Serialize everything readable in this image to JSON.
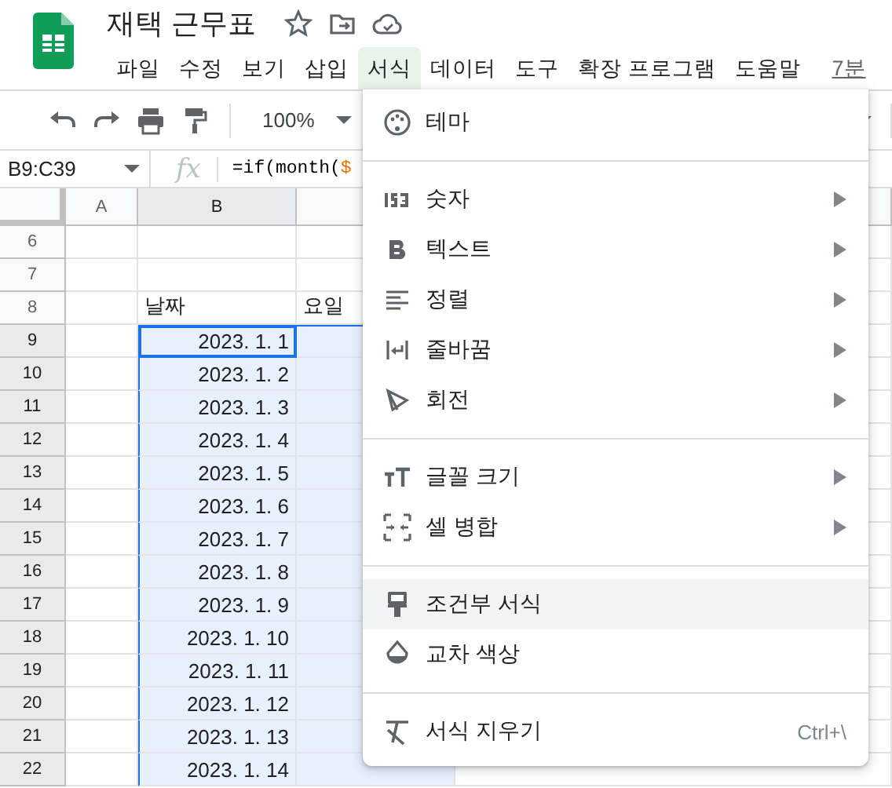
{
  "document": {
    "title": "재택 근무표"
  },
  "menubar": [
    {
      "label": "파일",
      "selected": false
    },
    {
      "label": "수정",
      "selected": false
    },
    {
      "label": "보기",
      "selected": false
    },
    {
      "label": "삽입",
      "selected": false
    },
    {
      "label": "서식",
      "selected": true
    },
    {
      "label": "데이터",
      "selected": false
    },
    {
      "label": "도구",
      "selected": false
    },
    {
      "label": "확장 프로그램",
      "selected": false
    },
    {
      "label": "도움말",
      "selected": false
    }
  ],
  "last_edit": "7분",
  "toolbar": {
    "zoom": "100%"
  },
  "formula_bar": {
    "name_box": "B9:C39",
    "fx": "fx",
    "formula": [
      {
        "text": "=if(month(",
        "color": "#000000"
      },
      {
        "text": "$",
        "color": "#e37400"
      }
    ]
  },
  "columns": [
    {
      "label": "A",
      "selected": false
    },
    {
      "label": "B",
      "selected": true
    }
  ],
  "rows": [
    {
      "number": "6",
      "selected": false,
      "active": false
    },
    {
      "number": "7",
      "selected": false,
      "active": false
    },
    {
      "number": "8",
      "b": "날짜",
      "c": "요일",
      "selected": false,
      "active": false
    },
    {
      "number": "9",
      "b": "2023. 1. 1",
      "selected": true,
      "active": true
    },
    {
      "number": "10",
      "b": "2023. 1. 2",
      "selected": true,
      "active": false
    },
    {
      "number": "11",
      "b": "2023. 1. 3",
      "selected": true,
      "active": false
    },
    {
      "number": "12",
      "b": "2023. 1. 4",
      "selected": true,
      "active": false
    },
    {
      "number": "13",
      "b": "2023. 1. 5",
      "selected": true,
      "active": false
    },
    {
      "number": "14",
      "b": "2023. 1. 6",
      "selected": true,
      "active": false
    },
    {
      "number": "15",
      "b": "2023. 1. 7",
      "selected": true,
      "active": false
    },
    {
      "number": "16",
      "b": "2023. 1. 8",
      "selected": true,
      "active": false
    },
    {
      "number": "17",
      "b": "2023. 1. 9",
      "selected": true,
      "active": false
    },
    {
      "number": "18",
      "b": "2023. 1. 10",
      "selected": true,
      "active": false
    },
    {
      "number": "19",
      "b": "2023. 1. 11",
      "selected": true,
      "active": false
    },
    {
      "number": "20",
      "b": "2023. 1. 12",
      "selected": true,
      "active": false
    },
    {
      "number": "21",
      "b": "2023. 1. 13",
      "selected": true,
      "active": false
    },
    {
      "number": "22",
      "b": "2023. 1. 14",
      "selected": true,
      "active": false
    }
  ],
  "format_menu": {
    "groups": [
      [
        {
          "label": "테마",
          "submenu": false,
          "highlighted": false
        }
      ],
      [
        {
          "label": "숫자",
          "submenu": true,
          "highlighted": false
        },
        {
          "label": "텍스트",
          "submenu": true,
          "highlighted": false
        },
        {
          "label": "정렬",
          "submenu": true,
          "highlighted": false
        },
        {
          "label": "줄바꿈",
          "submenu": true,
          "highlighted": false
        },
        {
          "label": "회전",
          "submenu": true,
          "highlighted": false
        }
      ],
      [
        {
          "label": "글꼴 크기",
          "submenu": true,
          "highlighted": false
        },
        {
          "label": "셀 병합",
          "submenu": true,
          "highlighted": false
        }
      ],
      [
        {
          "label": "조건부 서식",
          "submenu": false,
          "highlighted": true
        },
        {
          "label": "교차 색상",
          "submenu": false,
          "highlighted": false
        }
      ],
      [
        {
          "label": "서식 지우기",
          "submenu": false,
          "highlighted": false,
          "shortcut": "Ctrl+\\"
        }
      ]
    ]
  }
}
